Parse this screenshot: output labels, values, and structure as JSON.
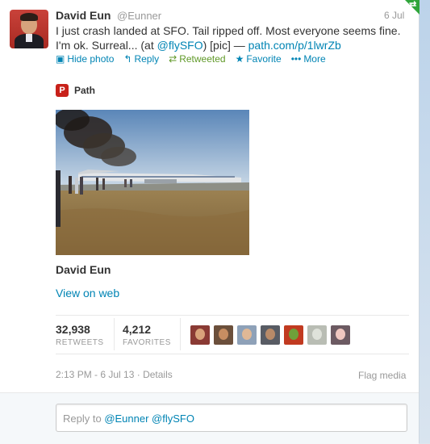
{
  "tweet": {
    "author_name": "David Eun",
    "handle": "@Eunner",
    "date": "6 Jul",
    "text_part1": "I just crash landed at SFO. Tail ripped off. Most everyone seems fine. I'm ok. Surreal... (at ",
    "mention": "@flySFO",
    "text_part2": ") [pic] — ",
    "link": "path.com/p/1lwrZb"
  },
  "actions": {
    "hide_photo": "Hide photo",
    "reply": "Reply",
    "retweeted": "Retweeted",
    "favorite": "Favorite",
    "more": "More"
  },
  "media": {
    "provider": "Path",
    "provider_icon": "P",
    "author": "David Eun",
    "view_on_web": "View on web"
  },
  "stats": {
    "retweets_count": "32,938",
    "retweets_label": "RETWEETS",
    "favorites_count": "4,212",
    "favorites_label": "FAVORITES"
  },
  "meta": {
    "timestamp": "2:13 PM - 6 Jul 13",
    "details": "Details",
    "flag_media": "Flag media"
  },
  "reply": {
    "prefix": "Reply to ",
    "mentions": "@Eunner @flySFO"
  },
  "colors": {
    "link": "#0084b4",
    "retweeted_green": "#609928",
    "path_red": "#c8211a"
  }
}
